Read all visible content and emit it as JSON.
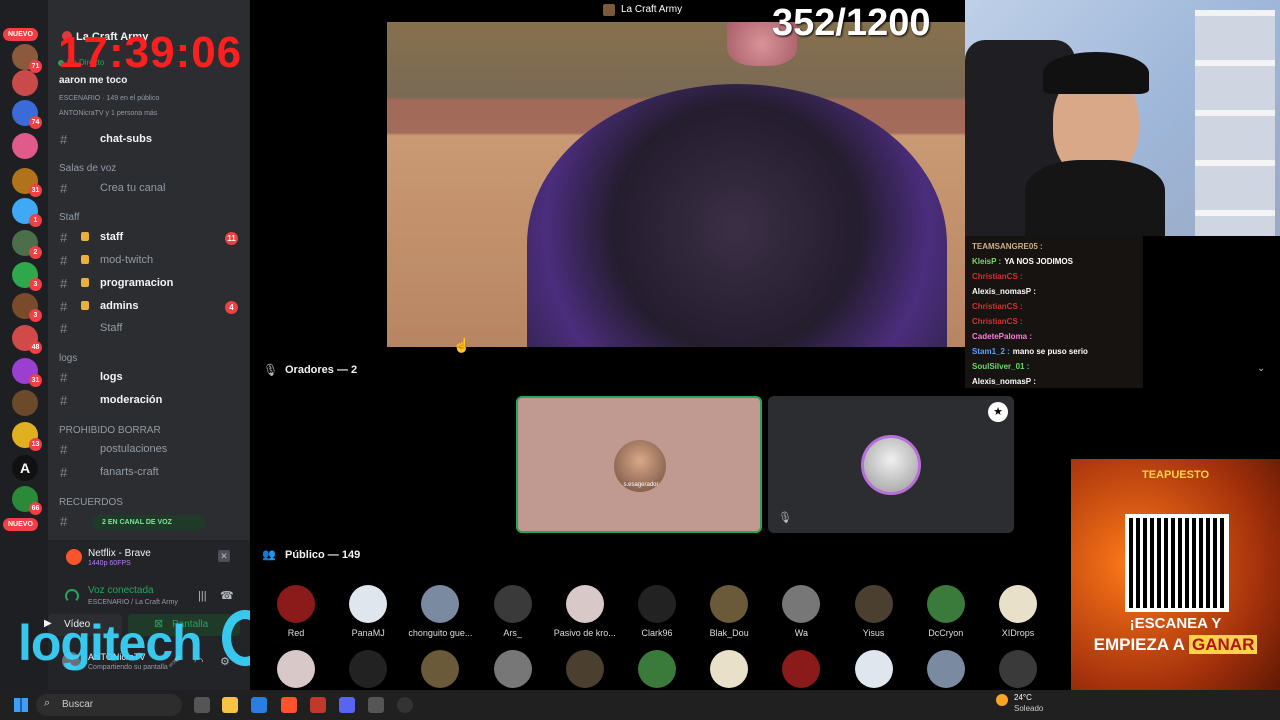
{
  "overlay": {
    "clock": "17:39:06",
    "counter": "352/1200",
    "logo_text": "logitech"
  },
  "window": {
    "title": "La Craft Army"
  },
  "rail": {
    "nuevo_top": "NUEVO",
    "nuevo_bottom": "NUEVO",
    "badges": [
      "71",
      "74",
      "31",
      "1",
      "2",
      "3",
      "3",
      "48",
      "31",
      "13",
      "66"
    ]
  },
  "server": {
    "name": "La Craft Army",
    "live_label": "En Directo",
    "event_title": "aaron me toco",
    "event_info": "ESCENARIO · 149 en el público",
    "event_people": "ANTONicraTV y 1 persona más"
  },
  "channels": [
    {
      "cat": null,
      "name": "chat-subs",
      "style": "bold",
      "lock": false,
      "count": null
    },
    {
      "cat": "Salas de voz",
      "name": "Crea tu canal",
      "style": "dim",
      "lock": false,
      "count": null
    },
    {
      "cat": "Staff",
      "name": "staff",
      "style": "bold",
      "lock": true,
      "count": "11"
    },
    {
      "cat": null,
      "name": "mod-twitch",
      "style": "dim",
      "lock": true,
      "count": null
    },
    {
      "cat": null,
      "name": "programacion",
      "style": "bold",
      "lock": true,
      "count": null
    },
    {
      "cat": null,
      "name": "admins",
      "style": "bold",
      "lock": true,
      "count": "4"
    },
    {
      "cat": null,
      "name": "Staff",
      "style": "dim",
      "lock": false,
      "count": null
    },
    {
      "cat": "logs",
      "name": "logs",
      "style": "bold",
      "lock": false,
      "count": null
    },
    {
      "cat": null,
      "name": "moderación",
      "style": "bold",
      "lock": false,
      "count": null
    },
    {
      "cat": "PROHIBIDO BORRAR",
      "name": "postulaciones",
      "style": "dim",
      "lock": false,
      "count": null
    },
    {
      "cat": null,
      "name": "fanarts-craft",
      "style": "dim",
      "lock": false,
      "count": null
    },
    {
      "cat": "RECUERDOS",
      "name": "",
      "style": "dim",
      "lock": false,
      "count": null
    }
  ],
  "voice_pill": "2 EN CANAL DE VOZ",
  "activity": {
    "title": "Netflix - Brave",
    "sub": "1440p 60FPS"
  },
  "voice": {
    "status": "Voz conectada",
    "location": "ESCENARIO / La Craft Army",
    "video_btn": "Vídeo",
    "screen_btn": "Pantalla"
  },
  "user": {
    "name": "ANTONicraTV",
    "status": "Compartiendo su pantalla"
  },
  "stage": {
    "speakers_label": "Oradores — 2",
    "audience_label": "Público — 149",
    "speaker_tile_label": "s.esagerador"
  },
  "audience": [
    "Red",
    "PanaMJ",
    "chonguito gue...",
    "Ars_",
    "Pasivo de kro...",
    "Clark96",
    "Blak_Dou",
    "Wa",
    "Yisus",
    "DcCryon",
    "XIDrops"
  ],
  "chat": [
    {
      "user": "TEAMSANGRE05 :",
      "msg": "",
      "color": "#c8b08a"
    },
    {
      "user": "KleisP :",
      "msg": "YA NOS JODIMOS",
      "color": "#7ad86b"
    },
    {
      "user": "ChristianCS :",
      "msg": "",
      "color": "#d83030"
    },
    {
      "user": "Alexis_nomasP :",
      "msg": "",
      "color": "#ffffff"
    },
    {
      "user": "ChristianCS :",
      "msg": "",
      "color": "#d83030"
    },
    {
      "user": "ChristianCS :",
      "msg": "",
      "color": "#d83030"
    },
    {
      "user": "CadetePaloma :",
      "msg": "",
      "color": "#ff7be0"
    },
    {
      "user": "Stam1_2 :",
      "msg": "mano se puso serio",
      "color": "#5aa0ff"
    },
    {
      "user": "SoulSilver_01 :",
      "msg": "",
      "color": "#6bd66b"
    },
    {
      "user": "Alexis_nomasP :",
      "msg": "",
      "color": "#ffffff"
    }
  ],
  "ad": {
    "brand": "TEAPUESTO",
    "line1": "¡ESCANEA Y",
    "line2": "EMPIEZA A",
    "line3": "GANAR"
  },
  "taskbar": {
    "search_placeholder": "Buscar",
    "weather_temp": "24°C",
    "weather_desc": "Soleado"
  },
  "colors": {
    "accent": "#23a55a",
    "danger": "#f23f43",
    "bg": "#2b2d31"
  }
}
